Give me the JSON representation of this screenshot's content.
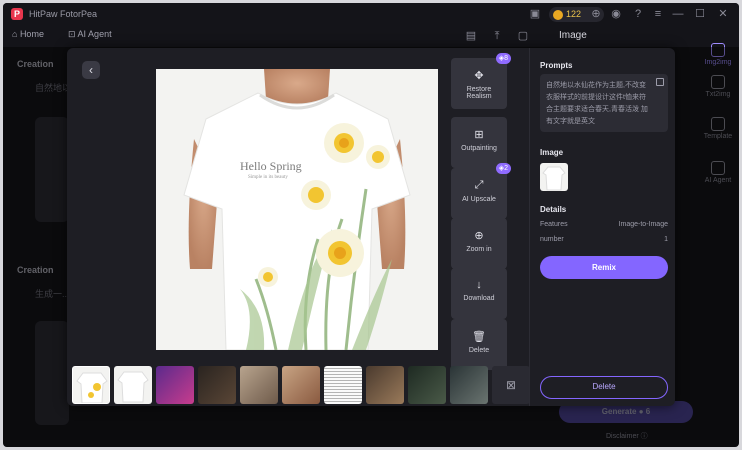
{
  "app": {
    "title": "HitPaw FotorPea",
    "logo_letter": "P",
    "credits": "122"
  },
  "nav": {
    "home": "Home",
    "ai_agent": "AI Agent"
  },
  "right_panel": {
    "title": "Image"
  },
  "rail": {
    "items": [
      {
        "label": "Img2img",
        "icon": "image-icon"
      },
      {
        "label": "Txt2img",
        "icon": "text-image-icon"
      },
      {
        "label": "Template",
        "icon": "grid-icon"
      },
      {
        "label": "AI Agent",
        "icon": "agent-icon"
      }
    ]
  },
  "background": {
    "creation_label_1": "Creation",
    "creation_sub_1": "自然地以水仙花...",
    "creation_label_2": "Creation",
    "creation_sub_2": "生成一...",
    "generate": "Generate",
    "generate_cost": "6",
    "disclaimer": "Disclaimer"
  },
  "modal": {
    "main_image": {
      "shirt_text": "Hello Spring",
      "shirt_subtext": "Simple in its beauty"
    },
    "tools": [
      {
        "label_1": "Restore",
        "label_2": "Realism",
        "badge": "8",
        "icon": "restore-icon"
      },
      {
        "label_1": "Outpainting",
        "label_2": "",
        "badge": "",
        "icon": "outpaint-icon"
      },
      {
        "label_1": "AI Upscale",
        "label_2": "",
        "badge": "2",
        "icon": "upscale-icon"
      },
      {
        "label_1": "Zoom in",
        "label_2": "",
        "badge": "",
        "icon": "zoom-in-icon"
      },
      {
        "label_1": "Download",
        "label_2": "",
        "badge": "",
        "icon": "download-icon"
      },
      {
        "label_1": "Delete",
        "label_2": "",
        "badge": "",
        "icon": "trash-icon"
      }
    ],
    "side": {
      "prompts_title": "Prompts",
      "prompt_text": "自然地以水仙花作为主题,不改变衣服样式的前提设计这件t恤来符合主题要求适合春天,青春活泼 加有文字就是英文",
      "image_title": "Image",
      "details_title": "Details",
      "details": [
        {
          "key": "Features",
          "value": "Image-to-Image"
        },
        {
          "key": "number",
          "value": "1"
        }
      ],
      "remix": "Remix",
      "delete": "Delete"
    }
  },
  "colors": {
    "accent": "#8466ff",
    "background": "#141419",
    "modal": "#1e1e24"
  }
}
